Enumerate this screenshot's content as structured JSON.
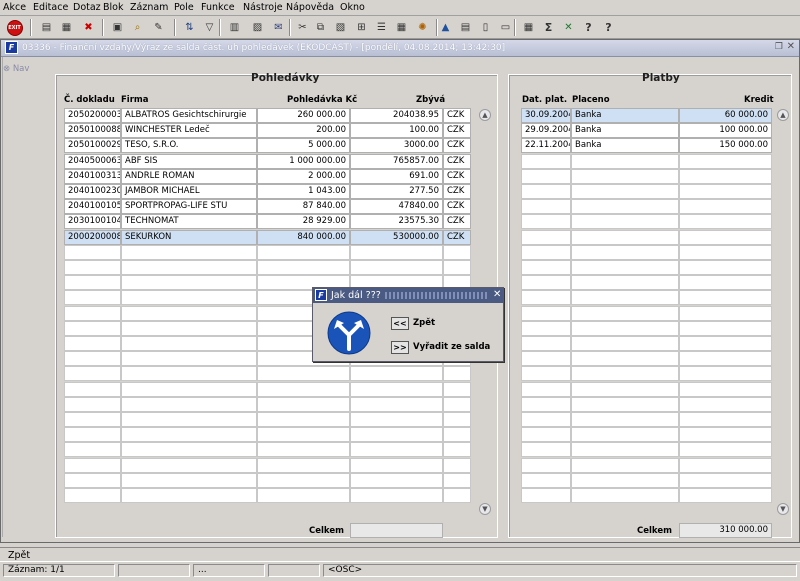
{
  "menu": [
    "Akce",
    "Editace",
    "Dotaz",
    "Blok",
    "Záznam",
    "Pole",
    "Funkce",
    "Nástroje",
    "Nápověda",
    "Okno"
  ],
  "toolbar": {
    "exit_label": "EXIT",
    "icons": [
      "exit-icon",
      "save-icon",
      "save-green-icon",
      "delete-icon",
      "open-folder-icon",
      "find-icon",
      "edit-icon",
      "sort-icon",
      "filter-icon",
      "print-icon",
      "print-preview-icon",
      "mail-icon",
      "cut-icon",
      "copy-icon",
      "paste-icon",
      "duplicate-icon",
      "list-icon",
      "calendar-icon",
      "settings-icon",
      "chart-icon",
      "report-icon",
      "document-icon",
      "new-document-icon",
      "calculator-icon",
      "sum-icon",
      "excel-icon",
      "help-icon",
      "context-help-icon"
    ]
  },
  "window": {
    "title": "03336 - Finanční vzdahy/Výraz ze salda část. uh pohledávek (EKODCAST) - [pondělí, 04.08.2014; 13:42:30]",
    "nav_label": "Nav",
    "app_icon": "F"
  },
  "pohledavky": {
    "title": "Pohledávky",
    "headers": {
      "doklad": "Č. dokladu",
      "firma": "Firma",
      "pohledavka": "Pohledávka Kč",
      "zbyva": "Zbývá"
    },
    "rows": [
      {
        "doklad": "2050200003",
        "firma": "ALBATROS Gesichtschirurgie",
        "pohledavka": "260 000.00",
        "zbyva": "204038.95",
        "mena": "CZK"
      },
      {
        "doklad": "2050100088",
        "firma": "WINCHESTER Ledeč",
        "pohledavka": "200.00",
        "zbyva": "100.00",
        "mena": "CZK"
      },
      {
        "doklad": "2050100029",
        "firma": "TESO, S.R.O.",
        "pohledavka": "5 000.00",
        "zbyva": "3000.00",
        "mena": "CZK"
      },
      {
        "doklad": "2040500063",
        "firma": "ABF SIS",
        "pohledavka": "1 000 000.00",
        "zbyva": "765857.00",
        "mena": "CZK"
      },
      {
        "doklad": "2040100313",
        "firma": "ANDRLE ROMAN",
        "pohledavka": "2 000.00",
        "zbyva": "691.00",
        "mena": "CZK"
      },
      {
        "doklad": "2040100230",
        "firma": "JAMBOR MICHAEL",
        "pohledavka": "1 043.00",
        "zbyva": "277.50",
        "mena": "CZK"
      },
      {
        "doklad": "2040100105",
        "firma": "SPORTPROPAG-LIFE STU",
        "pohledavka": "87 840.00",
        "zbyva": "47840.00",
        "mena": "CZK"
      },
      {
        "doklad": "2030100104",
        "firma": "TECHNOMAT",
        "pohledavka": "28 929.00",
        "zbyva": "23575.30",
        "mena": "CZK"
      },
      {
        "doklad": "2000200008",
        "firma": "SEKURKON",
        "pohledavka": "840 000.00",
        "zbyva": "530000.00",
        "mena": "CZK"
      }
    ],
    "selected_index": 8,
    "total_label": "Celkem",
    "total_value": ""
  },
  "platby": {
    "title": "Platby",
    "headers": {
      "datum": "Dat. plat.",
      "placeno": "Placeno",
      "kredit": "Kredit"
    },
    "rows": [
      {
        "datum": "30.09.2004",
        "placeno": "Banka",
        "kredit": "60 000.00"
      },
      {
        "datum": "29.09.2004",
        "placeno": "Banka",
        "kredit": "100 000.00"
      },
      {
        "datum": "22.11.2004",
        "placeno": "Banka",
        "kredit": "150 000.00"
      }
    ],
    "selected_index": 0,
    "total_label": "Celkem",
    "total_value": "310 000.00"
  },
  "dialog": {
    "title": "Jak dál ???",
    "back_button": "<<",
    "back_label": "Zpět",
    "forward_button": ">>",
    "forward_label": "Vyřadit ze salda"
  },
  "status": {
    "message": "Zpět",
    "record": "Záznam: 1/1",
    "field2": "",
    "field3": "...",
    "field4": "",
    "mode": "<OSC>"
  }
}
